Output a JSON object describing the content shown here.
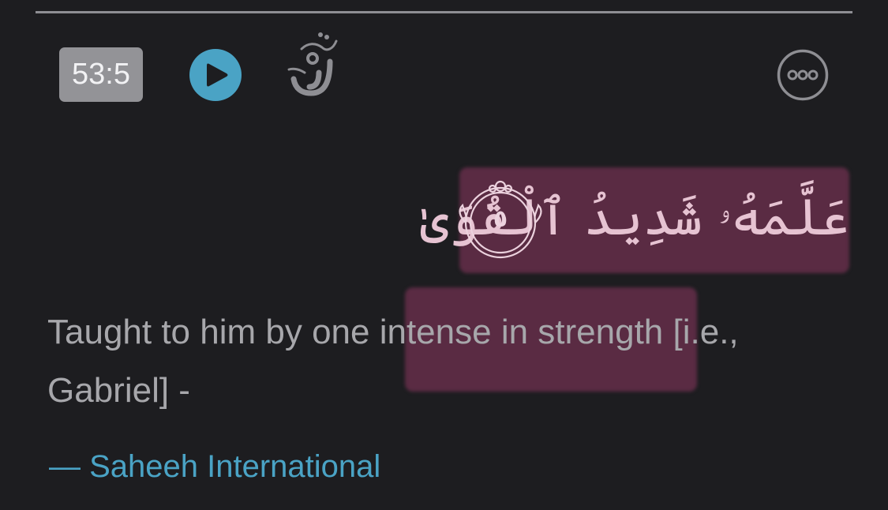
{
  "toolbar": {
    "verse_ref": "53:5",
    "play_icon": "play-icon",
    "logo_icon": "quran-logo-icon",
    "more_icon": "more-options-icon"
  },
  "verse": {
    "arabic": "عَلَّمَهُۥ شَدِيدُ ٱلْقُوَىٰ",
    "number": "٥",
    "translation_before": "Taught to him by one i",
    "translation_highlight": "ntense in strength",
    "translation_after": " [i.e., Gabriel] -",
    "attribution": "— Saheeh International"
  },
  "colors": {
    "background": "#1d1d20",
    "accent": "#4aa3c5",
    "highlight": "#5a2b43",
    "badge": "#939397",
    "text": "#a7a7ab",
    "arabic_text": "#e6c3d2"
  }
}
